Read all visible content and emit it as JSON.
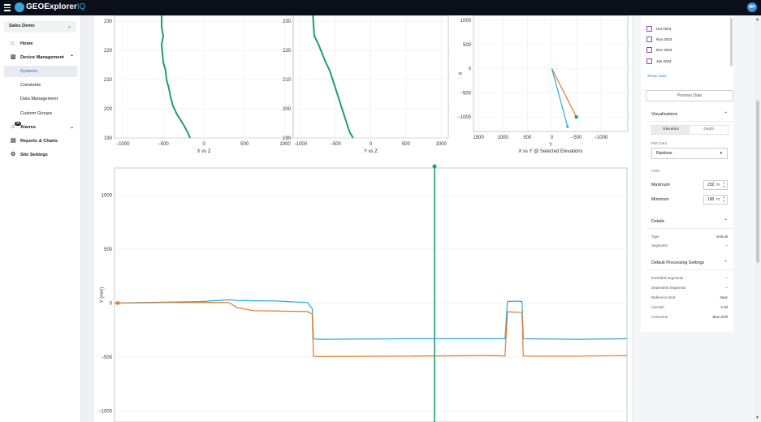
{
  "app": {
    "brand": "GEOExplorer",
    "brand_suffix": "IQ",
    "user_initials": "MP"
  },
  "sidebar": {
    "org": "Sales Demo",
    "items": [
      {
        "label": "Home",
        "icon": "home-icon"
      },
      {
        "label": "Device Management",
        "icon": "device-icon"
      },
      {
        "label": "Systems"
      },
      {
        "label": "Constants"
      },
      {
        "label": "Data Management"
      },
      {
        "label": "Custom Groups"
      },
      {
        "label": "Alarms",
        "icon": "bell-icon",
        "badge": "19"
      },
      {
        "label": "Reports & Charts",
        "icon": "reports-icon"
      },
      {
        "label": "Site Settings",
        "icon": "gear-icon"
      }
    ]
  },
  "right_panel": {
    "months": [
      "Oct 2023",
      "Nov 2023",
      "Dec 2023",
      "Jan 2024"
    ],
    "show_less": "Show Less",
    "process_button": "Process Data",
    "visualizations": {
      "title": "Visualizations",
      "tabs": [
        "Elevation",
        "Depth"
      ],
      "plot_color_label": "Plot Color",
      "plot_color": "Rainbow",
      "axis_label": "AXIS",
      "maximum_label": "Maximum",
      "maximum_value": "232",
      "minimum_label": "Minimum",
      "minimum_value": "190",
      "unit": "m"
    },
    "details": {
      "title": "Details",
      "rows": [
        {
          "key": "Type",
          "value": "Vertical"
        },
        {
          "key": "Segments",
          "value": "–"
        }
      ]
    },
    "processing": {
      "title": "Default Processing Settings",
      "rows": [
        {
          "key": "Excluded Segments",
          "value": "–"
        },
        {
          "key": "Dependent Segments",
          "value": "–"
        },
        {
          "key": "Reference End",
          "value": "Near"
        },
        {
          "key": "Azimuth",
          "value": "0 dd"
        },
        {
          "key": "Correction",
          "value": "Bias Shift"
        }
      ]
    }
  },
  "chart_data": [
    {
      "type": "line",
      "xlabel": "X vs Z",
      "ylim": [
        190,
        232
      ],
      "xlim": [
        -1100,
        1100
      ],
      "x_ticks": [
        -1000,
        -500,
        0,
        500,
        1000
      ],
      "y_ticks": [
        190,
        200,
        210,
        220,
        230
      ],
      "series": [
        {
          "color": "#1f9e6a",
          "points": [
            [
              -520,
              232
            ],
            [
              -520,
              228
            ],
            [
              -500,
              225
            ],
            [
              -520,
              222
            ],
            [
              -510,
              219
            ],
            [
              -500,
              216
            ],
            [
              -470,
              213
            ],
            [
              -460,
              210
            ],
            [
              -430,
              207
            ],
            [
              -410,
              204
            ],
            [
              -380,
              201
            ],
            [
              -330,
              198
            ],
            [
              -260,
              195
            ],
            [
              -200,
              192
            ],
            [
              -170,
              190
            ]
          ]
        }
      ]
    },
    {
      "type": "line",
      "xlabel": "Y vs Z",
      "ylim": [
        190,
        232
      ],
      "xlim": [
        -1100,
        1100
      ],
      "x_ticks": [
        -1000,
        -500,
        0,
        500,
        1000
      ],
      "y_ticks": [
        190,
        200,
        210,
        220,
        230
      ],
      "series": [
        {
          "color": "#1f9e6a",
          "points": [
            [
              -820,
              232
            ],
            [
              -810,
              228
            ],
            [
              -800,
              225
            ],
            [
              -740,
              222
            ],
            [
              -690,
              219
            ],
            [
              -640,
              216
            ],
            [
              -580,
              213
            ],
            [
              -540,
              210
            ],
            [
              -500,
              207
            ],
            [
              -460,
              204
            ],
            [
              -420,
              201
            ],
            [
              -380,
              198
            ],
            [
              -340,
              195
            ],
            [
              -300,
              192
            ],
            [
              -250,
              190
            ]
          ]
        }
      ]
    },
    {
      "type": "line",
      "xlabel": "Y",
      "subtitle": "X vs Y @ Selected Elevations",
      "ylabel": "X",
      "x_reversed": true,
      "xlim": [
        1600,
        -1550
      ],
      "ylim": [
        -1300,
        1100
      ],
      "x_ticks": [
        1500,
        1000,
        500,
        0,
        -500,
        -1000
      ],
      "y_ticks": [
        1000,
        500,
        0,
        -500,
        -1000
      ],
      "series": [
        {
          "color": "#e07b28",
          "points": [
            [
              0,
              0
            ],
            [
              -500,
              -1000
            ]
          ]
        },
        {
          "color": "#2aa9d8",
          "points": [
            [
              0,
              0
            ],
            [
              -320,
              -1200
            ]
          ]
        }
      ]
    },
    {
      "type": "line",
      "ylabel": "Y (mm)",
      "ylim": [
        -1100,
        1250
      ],
      "y_ticks": [
        1000,
        500,
        0,
        -500,
        -1000
      ],
      "series": [
        {
          "color": "#2aa9d8",
          "points": [
            [
              0,
              0
            ],
            [
              0.1,
              5
            ],
            [
              0.2,
              8
            ],
            [
              0.35,
              14
            ],
            [
              0.47,
              30
            ],
            [
              0.5,
              25
            ],
            [
              0.57,
              22
            ],
            [
              0.66,
              20
            ],
            [
              0.7,
              15
            ],
            [
              0.79,
              5
            ],
            [
              0.81,
              -50
            ],
            [
              0.815,
              -330
            ],
            [
              0.83,
              -335
            ],
            [
              1.2,
              -330
            ],
            [
              1.57,
              -330
            ],
            [
              1.6,
              -330
            ],
            [
              1.61,
              15
            ],
            [
              1.65,
              18
            ],
            [
              1.67,
              15
            ],
            [
              1.675,
              -330
            ],
            [
              1.9,
              -335
            ],
            [
              2.1,
              -330
            ]
          ]
        },
        {
          "color": "#e07b28",
          "points": [
            [
              0,
              0
            ],
            [
              0.1,
              2
            ],
            [
              0.2,
              5
            ],
            [
              0.35,
              6
            ],
            [
              0.47,
              5
            ],
            [
              0.5,
              -40
            ],
            [
              0.57,
              -70
            ],
            [
              0.66,
              -72
            ],
            [
              0.7,
              -75
            ],
            [
              0.79,
              -78
            ],
            [
              0.81,
              -100
            ],
            [
              0.815,
              -490
            ],
            [
              0.83,
              -495
            ],
            [
              1.2,
              -490
            ],
            [
              1.57,
              -485
            ],
            [
              1.6,
              -490
            ],
            [
              1.61,
              -80
            ],
            [
              1.65,
              -85
            ],
            [
              1.67,
              -85
            ],
            [
              1.675,
              -490
            ],
            [
              1.9,
              -490
            ],
            [
              2.1,
              -485
            ]
          ]
        }
      ]
    }
  ]
}
